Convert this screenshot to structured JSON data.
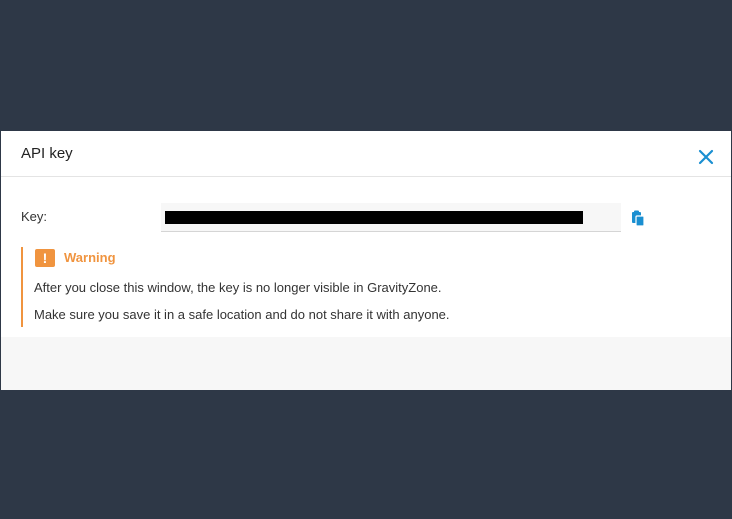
{
  "dialog": {
    "title": "API key",
    "close_icon": "close-icon"
  },
  "key": {
    "label": "Key:",
    "value_state": "redacted",
    "copy_icon": "clipboard-copy-icon"
  },
  "warning": {
    "icon": "warning-icon",
    "icon_glyph": "!",
    "title": "Warning",
    "lines": [
      "After you close this window, the key is no longer visible in GravityZone.",
      "Make sure you save it in a safe location and do not share it with anyone."
    ]
  },
  "colors": {
    "backdrop": "#2e3847",
    "accent": "#1a8fd1",
    "warning": "#f0943f"
  }
}
